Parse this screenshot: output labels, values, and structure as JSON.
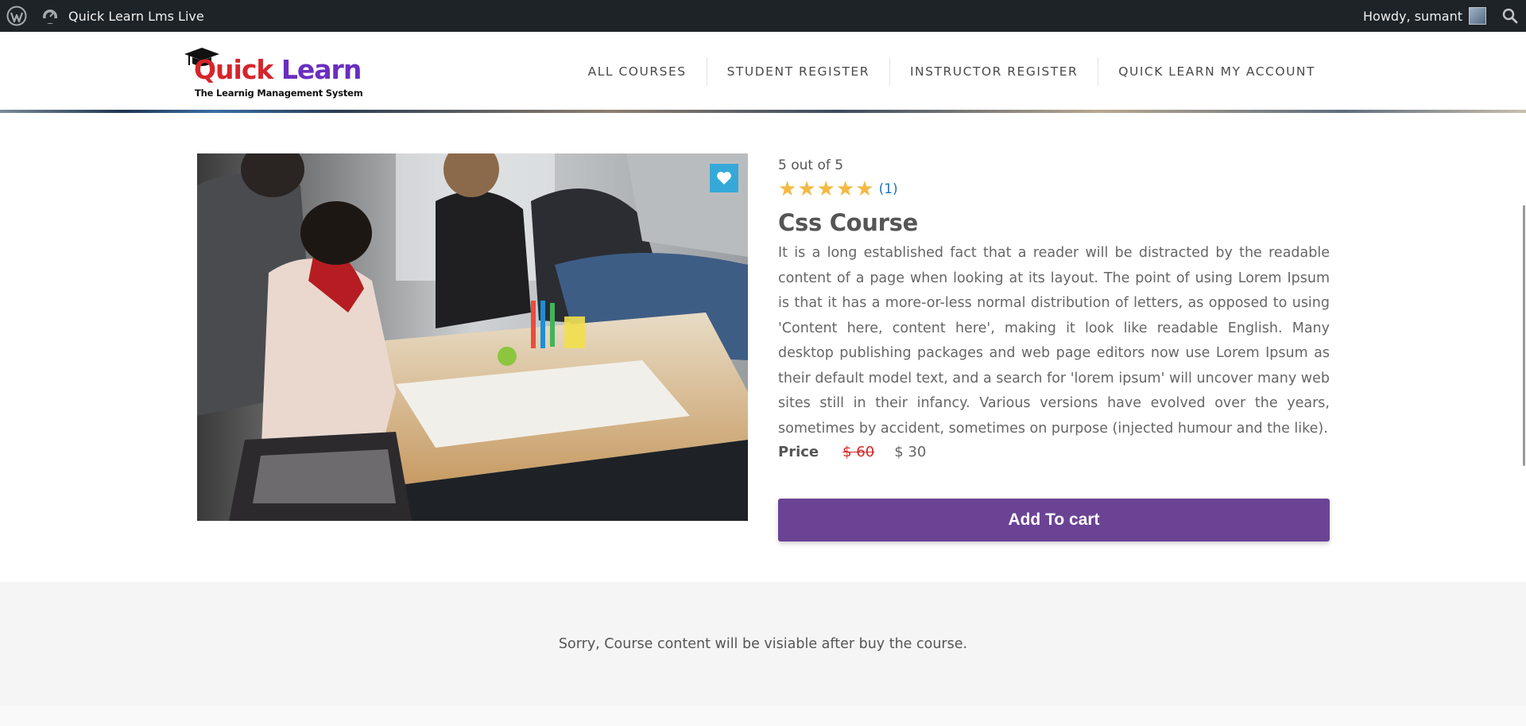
{
  "adminbar": {
    "site_name": "Quick Learn Lms Live",
    "howdy": "Howdy, sumant"
  },
  "logo": {
    "word1": "Quick",
    "word2": "Learn",
    "tagline": "The Learnig Management System"
  },
  "nav": {
    "items": [
      {
        "label": "ALL COURSES"
      },
      {
        "label": "STUDENT REGISTER"
      },
      {
        "label": "INSTRUCTOR REGISTER"
      },
      {
        "label": "QUICK LEARN MY ACCOUNT"
      }
    ]
  },
  "course": {
    "rating_text": "5 out of 5",
    "rating_value": 5,
    "rating_max": 5,
    "rating_count": "(1)",
    "title": "Css Course",
    "description": "It is a long established fact that a reader will be distracted by the readable content of a page when looking at its layout. The point of using Lorem Ipsum is that it has a more-or-less normal distribution of letters, as opposed to using 'Content here, content here', making it look like readable English. Many desktop publishing packages and web page editors now use Lorem Ipsum as their default model text, and a search for 'lorem ipsum' will uncover many web sites still in their infancy. Various versions have evolved over the years, sometimes by accident, sometimes on purpose (injected humour and the like).",
    "price_label": "Price",
    "price_old": "$ 60",
    "price_new": "$ 30",
    "add_to_cart": "Add To cart",
    "wishlist_icon": "heart-icon"
  },
  "notice": {
    "text": "Sorry, Course content will be visiable after buy the course."
  },
  "colors": {
    "adminbar_bg": "#1d2327",
    "brand_red": "#d6252b",
    "brand_purple": "#6a2ec0",
    "cart_button": "#6b4395",
    "wishlist_bg": "#36a9d8",
    "star": "#f4b942",
    "link": "#1e73be",
    "old_price": "#d02828"
  }
}
